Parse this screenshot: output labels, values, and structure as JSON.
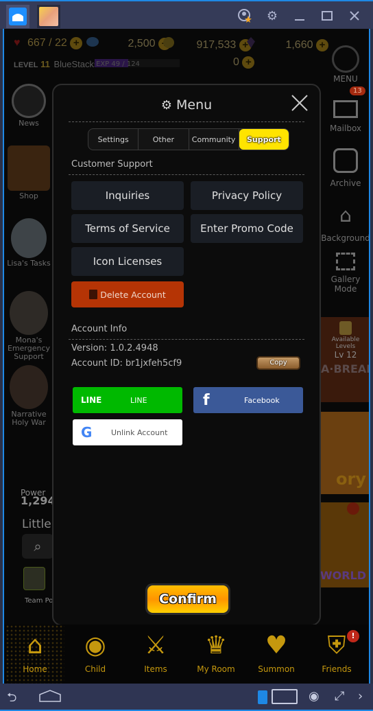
{
  "window": {
    "tabs": [
      {
        "name": "home",
        "icon": "home-icon"
      },
      {
        "name": "game-app",
        "icon": "app-avatar-icon"
      }
    ],
    "controls": {
      "account_icon": "account-star-icon",
      "settings_icon": "gear-icon",
      "minimize_icon": "minimize-icon",
      "maximize_icon": "maximize-icon",
      "close_icon": "close-icon"
    }
  },
  "hud": {
    "stamina": "667 / 22",
    "gems": "2,500",
    "gold": "917,533",
    "crystals": "1,660",
    "level_label": "LEVEL",
    "level_value": "11",
    "player_name": "BlueStacks",
    "exp": "EXP 49 / 124",
    "exp_fraction": 0.395,
    "tickets": "0"
  },
  "left_sidebar": [
    {
      "label": "News"
    },
    {
      "label": "Shop"
    },
    {
      "label": "Lisa's Tasks"
    },
    {
      "label": "Mona's Emergency Support"
    },
    {
      "label": "Narrative Holy War"
    }
  ],
  "left_lower": {
    "power_label": "Power",
    "power_value": "1,294",
    "little_label": "Little",
    "team_label": "Team Po"
  },
  "right_sidebar": [
    {
      "label": "MENU"
    },
    {
      "label": "Mailbox",
      "badge": "13"
    },
    {
      "label": "Archive"
    },
    {
      "label": "Background"
    },
    {
      "label": "Gallery Mode"
    }
  ],
  "right_banners": {
    "locked_label": "Available Levels",
    "locked_level": "Lv 12",
    "banner1": "A·BREAK",
    "banner2": "ory",
    "banner3": "WORLD"
  },
  "modal": {
    "title": "Menu",
    "tabs": [
      {
        "label": "Settings",
        "active": false
      },
      {
        "label": "Other",
        "active": false
      },
      {
        "label": "Community",
        "active": false
      },
      {
        "label": "Support",
        "active": true
      }
    ],
    "customer_support_label": "Customer Support",
    "buttons": {
      "inquiries": "Inquiries",
      "privacy_policy": "Privacy Policy",
      "terms_of_service": "Terms of Service",
      "enter_promo_code": "Enter Promo Code",
      "icon_licenses": "Icon Licenses",
      "delete_account": "Delete Account"
    },
    "account_info_label": "Account Info",
    "version": "Version: 1.0.2.4948",
    "account_id": "Account ID: br1jxfeh5cf9",
    "copy_label": "Copy",
    "social": {
      "line_logo": "LINE",
      "line_label": "LINE",
      "facebook_logo": "f",
      "facebook_label": "Facebook",
      "google_logo": "G",
      "google_label": "Unlink Account"
    },
    "confirm_label": "Confirm"
  },
  "bottom_nav": [
    {
      "label": "Home",
      "active": true
    },
    {
      "label": "Child"
    },
    {
      "label": "Items"
    },
    {
      "label": "My Room"
    },
    {
      "label": "Summon"
    },
    {
      "label": "Friends",
      "alert": "!"
    }
  ],
  "colors": {
    "accent_yellow": "#ffe400",
    "danger": "#b53405",
    "line_green": "#00b900",
    "facebook_blue": "#3b5998",
    "nav_gold": "#c5980e",
    "frame_blue": "#1e88e5"
  }
}
